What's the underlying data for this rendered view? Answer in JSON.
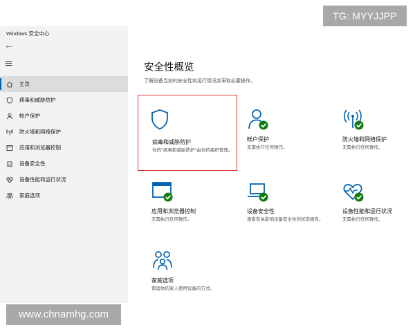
{
  "watermarks": {
    "top": "TG: MYYJJPP",
    "bottom": "www.chnamhg.com"
  },
  "window": {
    "title": "Windows 安全中心"
  },
  "sidebar": {
    "back_icon": "←",
    "items": [
      {
        "label": "主页",
        "icon": "home-icon"
      },
      {
        "label": "病毒和威胁防护",
        "icon": "shield-icon"
      },
      {
        "label": "帐户保护",
        "icon": "person-icon"
      },
      {
        "label": "防火墙和网络保护",
        "icon": "antenna-icon"
      },
      {
        "label": "应用和浏览器控制",
        "icon": "browser-window-icon"
      },
      {
        "label": "设备安全性",
        "icon": "laptop-icon"
      },
      {
        "label": "设备性能和运行状况",
        "icon": "heart-icon"
      },
      {
        "label": "家庭选项",
        "icon": "family-icon"
      }
    ],
    "active_index": 0
  },
  "main": {
    "title": "安全性概览",
    "subtitle": "了解设备当前的安全性和运行情况并采取必要操作。",
    "tiles": [
      {
        "title": "病毒和威胁防护",
        "desc": "你的\"病毒和威胁防护\"由你的组织管理。",
        "icon": "shield-icon",
        "status": "none"
      },
      {
        "title": "帐户保护",
        "desc": "无需执行任何操作。",
        "icon": "person-icon",
        "status": "ok"
      },
      {
        "title": "防火墙和网络保护",
        "desc": "无需执行任何操作。",
        "icon": "antenna-icon",
        "status": "ok"
      },
      {
        "title": "应用和浏览器控制",
        "desc": "无需执行任何操作。",
        "icon": "browser-window-icon",
        "status": "ok"
      },
      {
        "title": "设备安全性",
        "desc": "查看有关影响设备安全性的状态报告。",
        "icon": "laptop-icon",
        "status": "ok"
      },
      {
        "title": "设备性能和运行状况",
        "desc": "无需执行任何操作。",
        "icon": "heart-icon",
        "status": "ok"
      },
      {
        "title": "家庭选项",
        "desc": "管理你的家人使用设备的方式。",
        "icon": "family-icon",
        "status": "none"
      }
    ]
  },
  "colors": {
    "icon_blue": "#0063b1",
    "check_green": "#107c10",
    "highlight_red": "#d33a3a",
    "sidebar_bg": "#f2f2f2",
    "active_bg": "#dcdcdc"
  }
}
